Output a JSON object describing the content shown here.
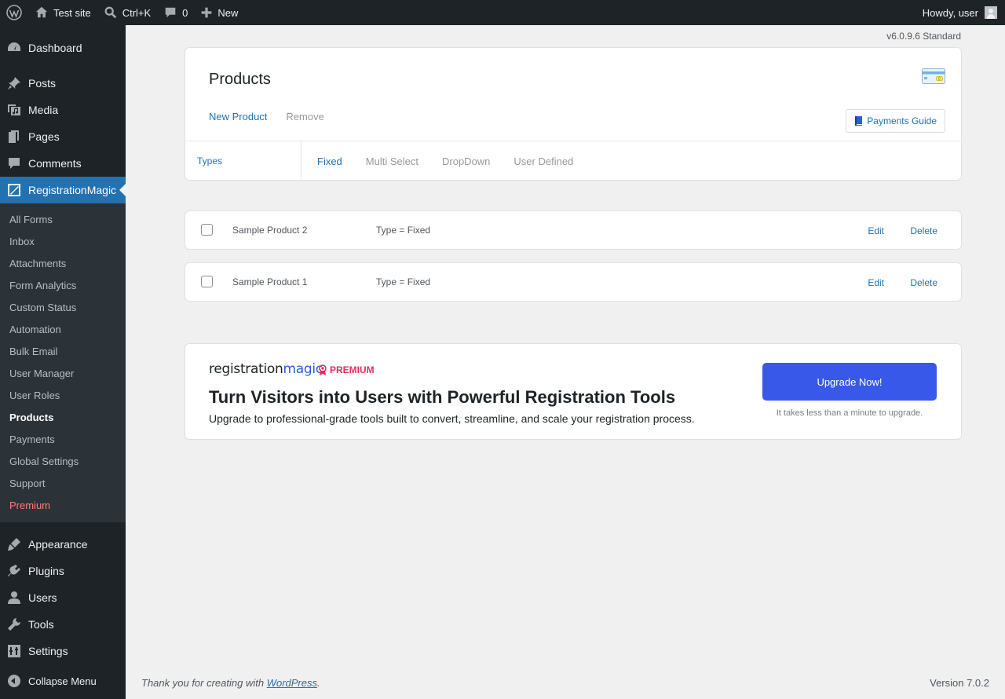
{
  "adminbar": {
    "site_name": "Test site",
    "search_shortcut": "Ctrl+K",
    "comments_count": "0",
    "new_label": "New",
    "howdy": "Howdy, user"
  },
  "sidebar": {
    "top_items": [
      {
        "label": "Dashboard",
        "icon": "dashboard-icon"
      },
      {
        "label": "Posts",
        "icon": "pin-icon"
      },
      {
        "label": "Media",
        "icon": "media-icon"
      },
      {
        "label": "Pages",
        "icon": "pages-icon"
      },
      {
        "label": "Comments",
        "icon": "comment-icon"
      },
      {
        "label": "RegistrationMagic",
        "icon": "registrationmagic-icon"
      }
    ],
    "submenu": [
      "All Forms",
      "Inbox",
      "Attachments",
      "Form Analytics",
      "Custom Status",
      "Automation",
      "Bulk Email",
      "User Manager",
      "User Roles",
      "Products",
      "Payments",
      "Global Settings",
      "Support",
      "Premium"
    ],
    "active_submenu": "Products",
    "bottom_items": [
      {
        "label": "Appearance",
        "icon": "brush-icon"
      },
      {
        "label": "Plugins",
        "icon": "plugin-icon"
      },
      {
        "label": "Users",
        "icon": "user-icon"
      },
      {
        "label": "Tools",
        "icon": "wrench-icon"
      },
      {
        "label": "Settings",
        "icon": "settings-icon"
      }
    ],
    "collapse_label": "Collapse Menu"
  },
  "main": {
    "version_top": "v6.0.9.6 Standard",
    "products_title": "Products",
    "new_product": "New Product",
    "remove": "Remove",
    "payments_guide": "Payments Guide",
    "types_label": "Types",
    "type_tabs": [
      "Fixed",
      "Multi Select",
      "DropDown",
      "User Defined"
    ],
    "active_type": "Fixed",
    "products": [
      {
        "name": "Sample Product 2",
        "type": "Type = Fixed",
        "edit": "Edit",
        "delete": "Delete"
      },
      {
        "name": "Sample Product 1",
        "type": "Type = Fixed",
        "edit": "Edit",
        "delete": "Delete"
      }
    ]
  },
  "promo": {
    "logo_part1": "registration",
    "logo_part2": "magic",
    "premium_badge": "PREMIUM",
    "headline": "Turn Visitors into Users with Powerful Registration Tools",
    "subtext": "Upgrade to professional-grade tools built to convert, streamline, and scale your registration process.",
    "upgrade_label": "Upgrade Now!",
    "upgrade_note": "It takes less than a minute to upgrade."
  },
  "footer": {
    "thanks_prefix": "Thank you for creating with ",
    "wordpress_link": "WordPress",
    "thanks_suffix": ".",
    "version": "Version 7.0.2"
  },
  "colors": {
    "admin_dark": "#1d2327",
    "wp_blue": "#2271b1",
    "upgrade_blue": "#3858e9",
    "premium_red": "#ff7c78"
  }
}
